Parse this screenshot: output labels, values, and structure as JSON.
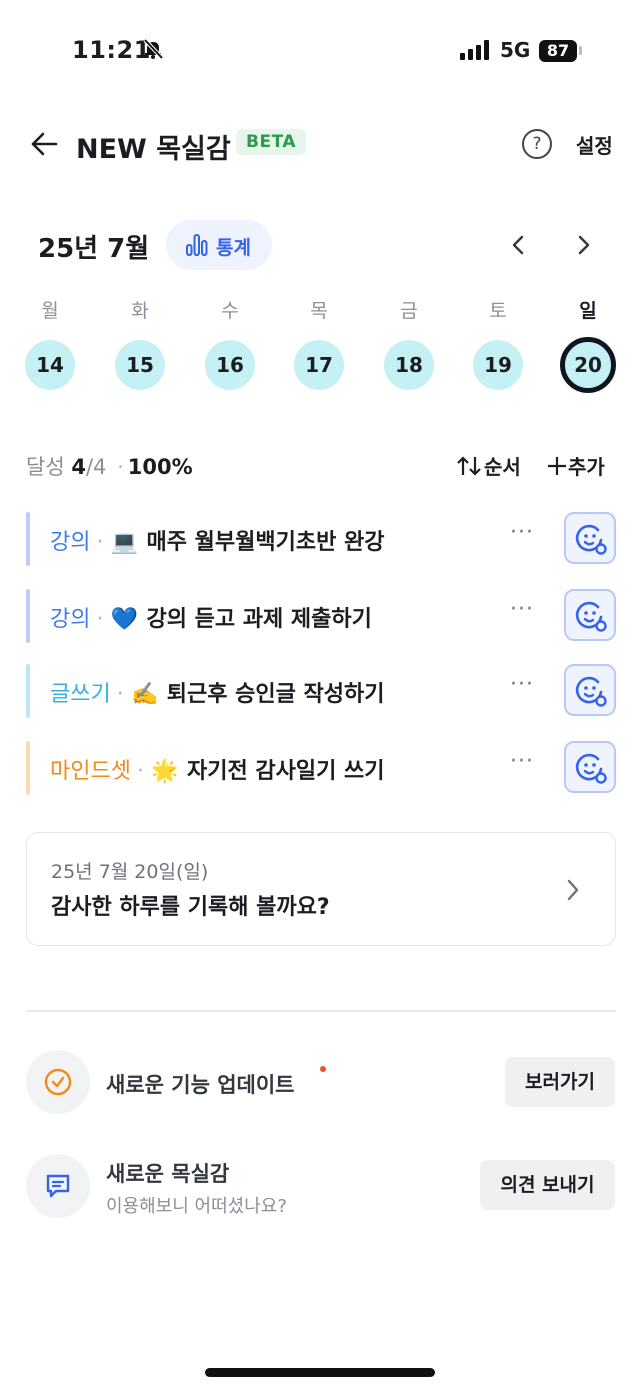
{
  "status_bar": {
    "time": "11:21",
    "network": "5G",
    "battery": "87"
  },
  "header": {
    "title": "NEW 목실감",
    "badge": "BETA",
    "help_icon": "?",
    "settings_label": "설정"
  },
  "calendar": {
    "month_label": "25년 7월",
    "stats_label": "통계",
    "weekdays": [
      "월",
      "화",
      "수",
      "목",
      "금",
      "토",
      "일"
    ],
    "days": [
      "14",
      "15",
      "16",
      "17",
      "18",
      "19",
      "20"
    ],
    "selected_day": "20"
  },
  "progress": {
    "label": "달성",
    "done": "4",
    "total": "/4",
    "percent": "100%",
    "separator": "·"
  },
  "actions": {
    "order_label": "순서",
    "add_label": "추가"
  },
  "tasks": [
    {
      "category": "강의",
      "emoji": "💻",
      "name": "매주 월부월백기초반 완강",
      "category_color": "#3b7ded",
      "bar_color": "#bccdf6"
    },
    {
      "category": "강의",
      "emoji": "💙",
      "name": "강의 듣고 과제 제출하기",
      "category_color": "#3b7ded",
      "bar_color": "#bccdf6"
    },
    {
      "category": "글쓰기",
      "emoji": "✍️",
      "name": "퇴근후 승인글 작성하기",
      "category_color": "#34b1de",
      "bar_color": "#bfe6f5"
    },
    {
      "category": "마인드셋",
      "emoji": "🌟",
      "name": "자기전 감사일기 쓰기",
      "category_color": "#f28a1a",
      "bar_color": "#fbd9b1"
    }
  ],
  "task_more_label": "···",
  "record_card": {
    "date": "25년 7월 20일(일)",
    "prompt": "감사한 하루를 기록해 볼까요?"
  },
  "feature_update": {
    "title": "새로운 기능 업데이트",
    "button": "보러가기"
  },
  "feedback": {
    "title": "새로운 목실감",
    "subtitle": "이용해보니 어떠셨나요?",
    "button": "의견 보내기"
  },
  "icons": {
    "back": "arrow-left-icon",
    "help": "question-circle-icon",
    "stats": "bar-chart-icon",
    "prev": "chevron-left-icon",
    "next": "chevron-right-icon",
    "order": "sort-arrows-icon",
    "add": "plus-icon",
    "face": "smiley-settings-icon",
    "check": "check-circle-icon",
    "chat": "chat-bubble-icon"
  }
}
